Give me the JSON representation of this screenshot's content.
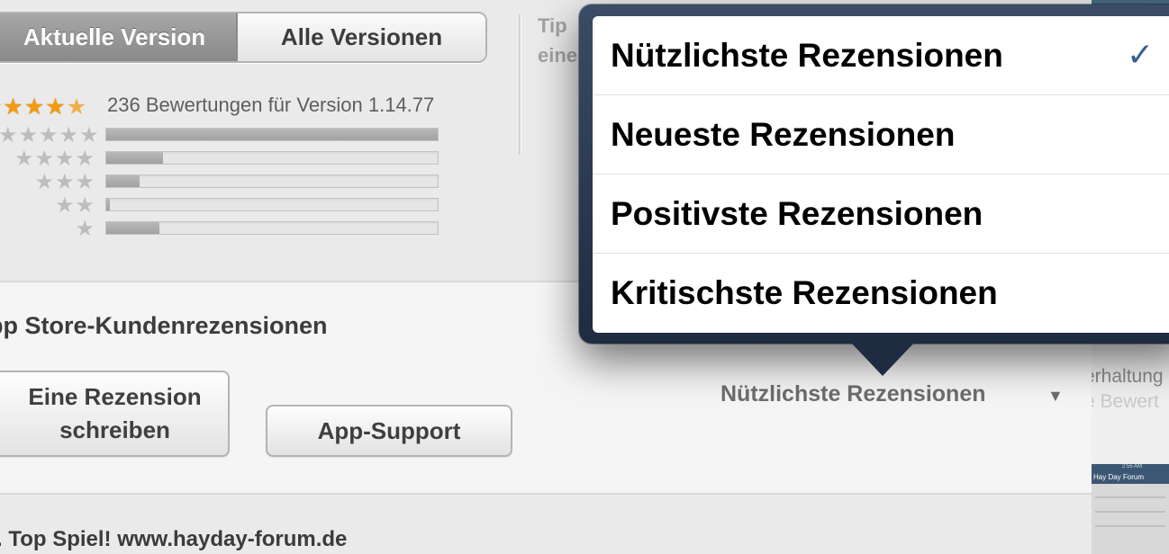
{
  "segmented_control": {
    "active": "Aktuelle Version",
    "inactive": "Alle Versionen"
  },
  "ratings": {
    "summary": "236 Bewertungen für Version 1.14.77",
    "average_stars": 4.5,
    "distribution": [
      {
        "stars": 5,
        "fraction": 1.0
      },
      {
        "stars": 4,
        "fraction": 0.17
      },
      {
        "stars": 3,
        "fraction": 0.1
      },
      {
        "stars": 2,
        "fraction": 0.01
      },
      {
        "stars": 1,
        "fraction": 0.16
      }
    ]
  },
  "tip_text": "Tip\neine",
  "reviews": {
    "heading": "pp Store-Kundenrezensionen",
    "write_button": "Eine Rezension schreiben",
    "support_button": "App-Support",
    "sort_label": "Nützlichste Rezensionen",
    "sort_arrow": "▼",
    "first_review_title": ". Top Spiel! www.hayday-forum.de"
  },
  "side_panel": {
    "line1": "erhaltung",
    "line2": "e Bewert",
    "thumbnail_label": "Hay Day Forum",
    "thumbnail_time": "2:55 AM"
  },
  "sort_menu": {
    "items": [
      {
        "label": "Nützlichste Rezensionen",
        "selected": true
      },
      {
        "label": "Neueste Rezensionen",
        "selected": false
      },
      {
        "label": "Positivste Rezensionen",
        "selected": false
      },
      {
        "label": "Kritischste Rezensionen",
        "selected": false
      }
    ],
    "check_mark": "✓"
  },
  "colors": {
    "star_on": "#f29a12",
    "star_off": "#bdbdbd",
    "popover_frame": "#2a3a52",
    "check": "#375d92"
  },
  "icons": [
    "star-icon",
    "checkmark-icon",
    "dropdown-arrow-icon"
  ]
}
